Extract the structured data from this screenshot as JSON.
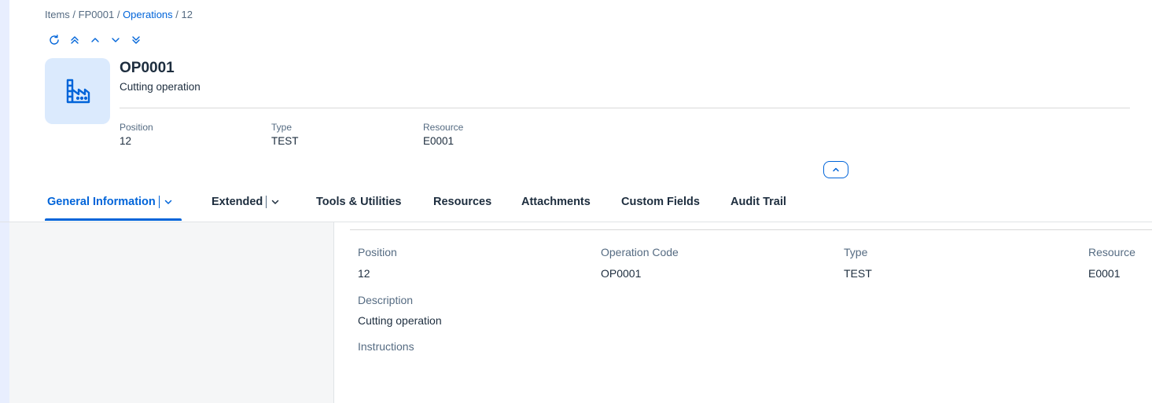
{
  "breadcrumb": {
    "items": [
      "Items",
      "FP0001",
      "Operations",
      "12"
    ],
    "separator": "/"
  },
  "navigation": {
    "icons": [
      "refresh-icon",
      "double-chevron-up-icon",
      "chevron-up-icon",
      "chevron-down-icon",
      "double-chevron-down-icon"
    ]
  },
  "header": {
    "title": "OP0001",
    "subtitle": "Cutting operation",
    "avatar_icon": "factory-icon",
    "attributes": [
      {
        "label": "Position",
        "value": "12"
      },
      {
        "label": "Type",
        "value": "TEST"
      },
      {
        "label": "Resource",
        "value": "E0001"
      }
    ]
  },
  "tabs": [
    {
      "label": "General Information",
      "active": true,
      "has_menu": true
    },
    {
      "label": "Extended",
      "active": false,
      "has_menu": true
    },
    {
      "label": "Tools & Utilities",
      "active": false,
      "has_menu": false
    },
    {
      "label": "Resources",
      "active": false,
      "has_menu": false
    },
    {
      "label": "Attachments",
      "active": false,
      "has_menu": false
    },
    {
      "label": "Custom Fields",
      "active": false,
      "has_menu": false
    },
    {
      "label": "Audit Trail",
      "active": false,
      "has_menu": false
    }
  ],
  "details": {
    "position": {
      "label": "Position",
      "value": "12"
    },
    "operation_code": {
      "label": "Operation Code",
      "value": "OP0001"
    },
    "type": {
      "label": "Type",
      "value": "TEST"
    },
    "resource": {
      "label": "Resource",
      "value": "E0001"
    },
    "description": {
      "label": "Description",
      "value": "Cutting operation"
    },
    "instructions": {
      "label": "Instructions",
      "value": ""
    }
  },
  "colors": {
    "accent": "#0064d9",
    "text": "#1d2d3e",
    "label": "#556b82",
    "avatar_bg": "#dbeafd",
    "side_pane": "#f5f6f7"
  }
}
